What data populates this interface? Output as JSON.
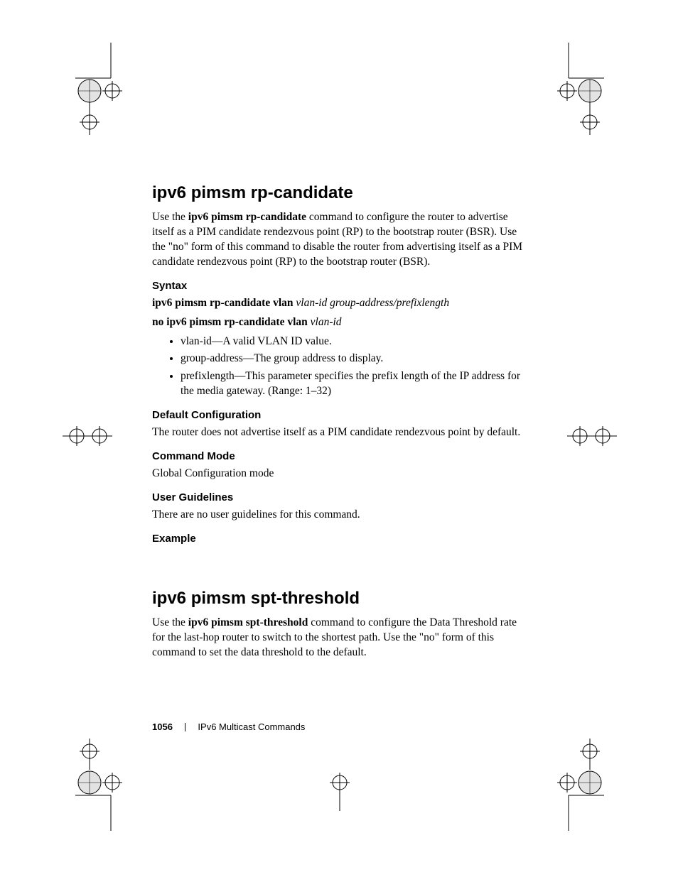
{
  "section1": {
    "title": "ipv6 pimsm rp-candidate",
    "intro_pre": "Use the ",
    "intro_bold": "ipv6 pimsm rp-candidate",
    "intro_post": " command to configure the router to advertise itself as a PIM candidate rendezvous point (RP) to the bootstrap router (BSR). Use the \"no\" form of this command to disable the router from advertising itself as a PIM candidate rendezvous point (RP) to the bootstrap router (BSR).",
    "syntax_heading": "Syntax",
    "syntax_line1_bold": "ipv6 pimsm rp-candidate vlan ",
    "syntax_line1_italic": "vlan-id group-address/prefixlength",
    "syntax_line2_bold": "no ipv6 pimsm rp-candidate vlan ",
    "syntax_line2_italic": "vlan-id",
    "bullets": {
      "b1": "vlan-id—A valid VLAN ID value.",
      "b2": "group-address—The group address to display.",
      "b3": "prefixlength—This parameter specifies the prefix length of the IP address for the media gateway. (Range: 1–32)"
    },
    "default_heading": "Default Configuration",
    "default_text": "The router does not advertise itself as a PIM candidate rendezvous point by default.",
    "mode_heading": "Command Mode",
    "mode_text": "Global Configuration mode",
    "guidelines_heading": "User Guidelines",
    "guidelines_text": "There are no user guidelines for this command.",
    "example_heading": "Example"
  },
  "section2": {
    "title": "ipv6 pimsm spt-threshold",
    "intro_pre": "Use the ",
    "intro_bold": "ipv6 pimsm spt-threshold",
    "intro_post": " command to configure the Data Threshold rate for the last-hop router to switch to the shortest path. Use the \"no\" form of this command to set the data threshold to the default."
  },
  "footer": {
    "page": "1056",
    "text": "IPv6 Multicast Commands"
  }
}
